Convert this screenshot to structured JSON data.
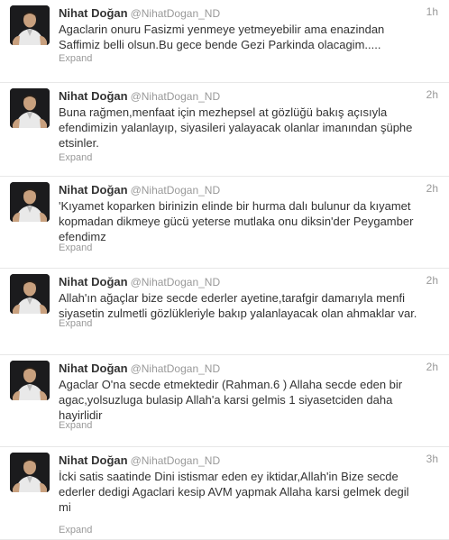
{
  "colors": {
    "text": "#333333",
    "meta": "#999999",
    "divider": "#e8e8e8",
    "avatar_bg": "#1b1b1d"
  },
  "icons": {
    "avatar": "profile-photo"
  },
  "tweets": [
    {
      "name": "Nihat Doğan",
      "handle": "@NihatDogan_ND",
      "time": "1h",
      "lines": [
        "Agaclarin onuru Fasizmi yenmeye yetmeyebilir ama enazindan",
        "Saffimiz belli olsun.Bu gece bende Gezi Parkinda olacagim....."
      ],
      "expand": "Expand"
    },
    {
      "name": "Nihat Doğan",
      "handle": "@NihatDogan_ND",
      "time": "2h",
      "lines": [
        "Buna rağmen,menfaat için mezhepsel at gözlüğü bakış açısıyla",
        "efendimizin yalanlayıp, siyasileri yalayacak olanlar imanından şüphe",
        "etsinler."
      ],
      "expand": "Expand"
    },
    {
      "name": "Nihat Doğan",
      "handle": "@NihatDogan_ND",
      "time": "2h",
      "lines": [
        "'Kıyamet koparken birinizin elinde bir hurma dalı bulunur da kıyamet",
        "kopmadan dikmeye gücü yeterse mutlaka onu diksin'der Peygamber",
        "efendimz"
      ],
      "expand": "Expand"
    },
    {
      "name": "Nihat Doğan",
      "handle": "@NihatDogan_ND",
      "time": "2h",
      "lines": [
        "Allah'ın ağaçlar bize secde ederler ayetine,tarafgir damarıyla menfi",
        "siyasetin zulmetli gözlükleriyle bakıp yalanlayacak olan ahmaklar var."
      ],
      "expand": "Expand"
    },
    {
      "name": "Nihat Doğan",
      "handle": "@NihatDogan_ND",
      "time": "2h",
      "lines": [
        "Agaclar O'na secde etmektedir (Rahman.6 )  Allaha secde eden bir",
        "agac,yolsuzluga bulasip Allah'a karsi gelmis 1 siyasetciden daha",
        "hayirlidir"
      ],
      "expand": "Expand"
    },
    {
      "name": "Nihat Doğan",
      "handle": "@NihatDogan_ND",
      "time": "3h",
      "lines": [
        "İcki satis saatinde Dini istismar eden ey iktidar,Allah'in Bize secde",
        "ederler dedigi  Agaclari kesip AVM yapmak Allaha karsi gelmek degil",
        "mi"
      ],
      "expand": "Expand"
    }
  ]
}
